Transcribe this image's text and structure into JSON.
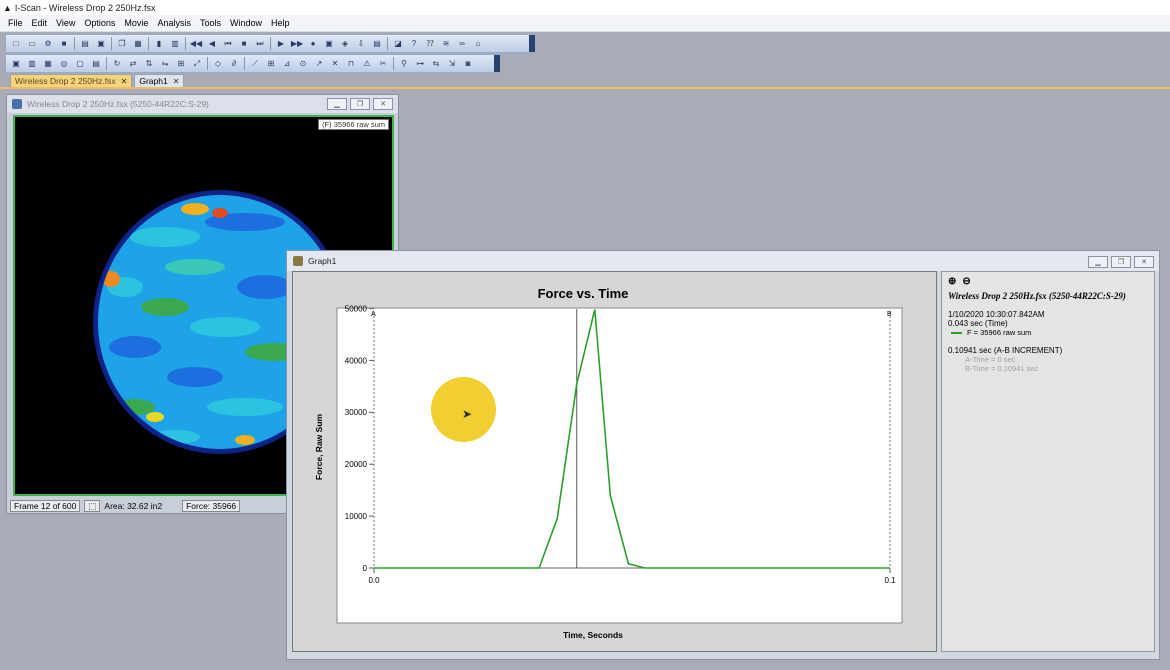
{
  "app": {
    "title": "I-Scan - Wireless Drop 2 250Hz.fsx"
  },
  "menu": [
    "File",
    "Edit",
    "View",
    "Options",
    "Movie",
    "Analysis",
    "Tools",
    "Window",
    "Help"
  ],
  "doc_tabs": [
    {
      "label": "Wireless Drop 2 250Hz.fsx",
      "active": true
    },
    {
      "label": "Graph1",
      "active": false
    }
  ],
  "map_window": {
    "title": "Wireless Drop 2 250Hz.fsx  (5250-44R22C:S-29)",
    "overlay": "(F) 35966 raw sum",
    "status": {
      "frame": "Frame 12 of 600",
      "area": "Area: 32.62 in2",
      "force": "Force: 35966"
    }
  },
  "graph_window": {
    "title": "Graph1",
    "side": {
      "sensor": "Wireless Drop 2 250Hz.fsx (5250-44R22C:S-29)",
      "datetime": "1/10/2020 10:30:07.842AM",
      "time": "0.043 sec (Time)",
      "legend": "F = 35966 raw sum",
      "increment": "0.10941 sec (A-B INCREMENT)",
      "a_time": "A-Time = 0 sec",
      "b_time": "B-Time = 0.10941 sec"
    }
  },
  "chart_data": {
    "type": "line",
    "title": "Force vs. Time",
    "xlabel": "Time, Seconds",
    "ylabel": "Force, Raw Sum",
    "xlim": [
      0,
      0.1
    ],
    "ylim": [
      0,
      52000
    ],
    "x_tick_labels": [
      "0.0",
      "0.1"
    ],
    "y_ticks": [
      0,
      10000,
      20000,
      30000,
      40000,
      50000
    ],
    "markers": {
      "a_label": "A",
      "b_label": "B",
      "a_x": 0.0,
      "b_x": 0.1
    },
    "cursor_x": 0.0393,
    "series": [
      {
        "color": "#2aa02a",
        "x": [
          0.0,
          0.032,
          0.0355,
          0.0393,
          0.0428,
          0.0458,
          0.0493,
          0.0525,
          0.056,
          0.1
        ],
        "y": [
          0,
          0,
          9500,
          35500,
          49800,
          14000,
          800,
          0,
          0,
          0
        ]
      }
    ]
  }
}
